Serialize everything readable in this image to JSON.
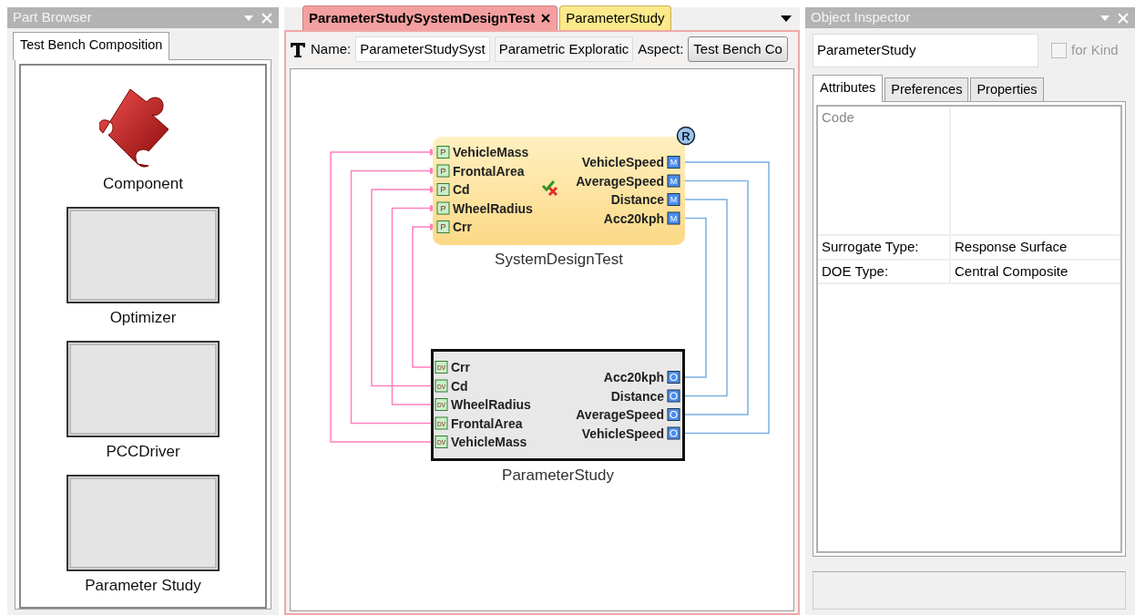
{
  "part_browser": {
    "title": "Part Browser",
    "tabs": [
      {
        "label": "Test Bench Composition",
        "selected": true
      }
    ],
    "parts": [
      {
        "label": "Component",
        "kind": "puzzle"
      },
      {
        "label": "Optimizer",
        "kind": "box"
      },
      {
        "label": "PCCDriver",
        "kind": "box"
      },
      {
        "label": "Parameter Study",
        "kind": "box"
      }
    ]
  },
  "editor": {
    "tabs": [
      {
        "label": "ParameterStudySystemDesignTest",
        "selected": true,
        "closable": true
      },
      {
        "label": "ParameterStudy",
        "selected": false,
        "closable": false
      }
    ],
    "toolbar": {
      "name_label": "Name:",
      "name_value": "ParameterStudySyst",
      "kind_value": "Parametric Exploratic",
      "aspect_label": "Aspect:",
      "aspect_value": "Test Bench Co"
    },
    "diagram": {
      "nodes": [
        {
          "name": "SystemDesignTest",
          "kind": "test_bench",
          "badge": "R",
          "validated": true,
          "inputs": [
            {
              "label": "VehicleMass",
              "badge": "P"
            },
            {
              "label": "FrontalArea",
              "badge": "P"
            },
            {
              "label": "Cd",
              "badge": "P"
            },
            {
              "label": "WheelRadius",
              "badge": "P"
            },
            {
              "label": "Crr",
              "badge": "P"
            }
          ],
          "outputs": [
            {
              "label": "VehicleSpeed",
              "badge": "M"
            },
            {
              "label": "AverageSpeed",
              "badge": "M"
            },
            {
              "label": "Distance",
              "badge": "M"
            },
            {
              "label": "Acc20kph",
              "badge": "M"
            }
          ]
        },
        {
          "name": "ParameterStudy",
          "kind": "parameter_study",
          "inputs": [
            {
              "label": "Crr",
              "badge": "DV"
            },
            {
              "label": "Cd",
              "badge": "DV"
            },
            {
              "label": "WheelRadius",
              "badge": "DV"
            },
            {
              "label": "FrontalArea",
              "badge": "DV"
            },
            {
              "label": "VehicleMass",
              "badge": "DV"
            }
          ],
          "outputs": [
            {
              "label": "Acc20kph"
            },
            {
              "label": "Distance"
            },
            {
              "label": "AverageSpeed"
            },
            {
              "label": "VehicleSpeed"
            }
          ]
        }
      ],
      "connections": [
        {
          "kind": "parameter"
        },
        {
          "kind": "parameter"
        },
        {
          "kind": "parameter"
        },
        {
          "kind": "parameter"
        },
        {
          "kind": "parameter"
        },
        {
          "kind": "metric"
        },
        {
          "kind": "metric"
        },
        {
          "kind": "metric"
        },
        {
          "kind": "metric"
        }
      ]
    }
  },
  "object_inspector": {
    "title": "Object Inspector",
    "name_value": "ParameterStudy",
    "for_kind": {
      "label": "for Kind",
      "checked": false,
      "disabled": true
    },
    "tabs": [
      {
        "label": "Attributes",
        "selected": true
      },
      {
        "label": "Preferences",
        "selected": false
      },
      {
        "label": "Properties",
        "selected": false
      }
    ],
    "attributes": [
      {
        "label": "Code",
        "kind": "multiline",
        "disabled": true
      },
      {
        "label": "Surrogate Type:",
        "value": "Response Surface",
        "kind": "text",
        "disabled": false
      },
      {
        "label": "DOE Type:",
        "value": "Central Composite",
        "kind": "text",
        "disabled": false
      }
    ]
  }
}
